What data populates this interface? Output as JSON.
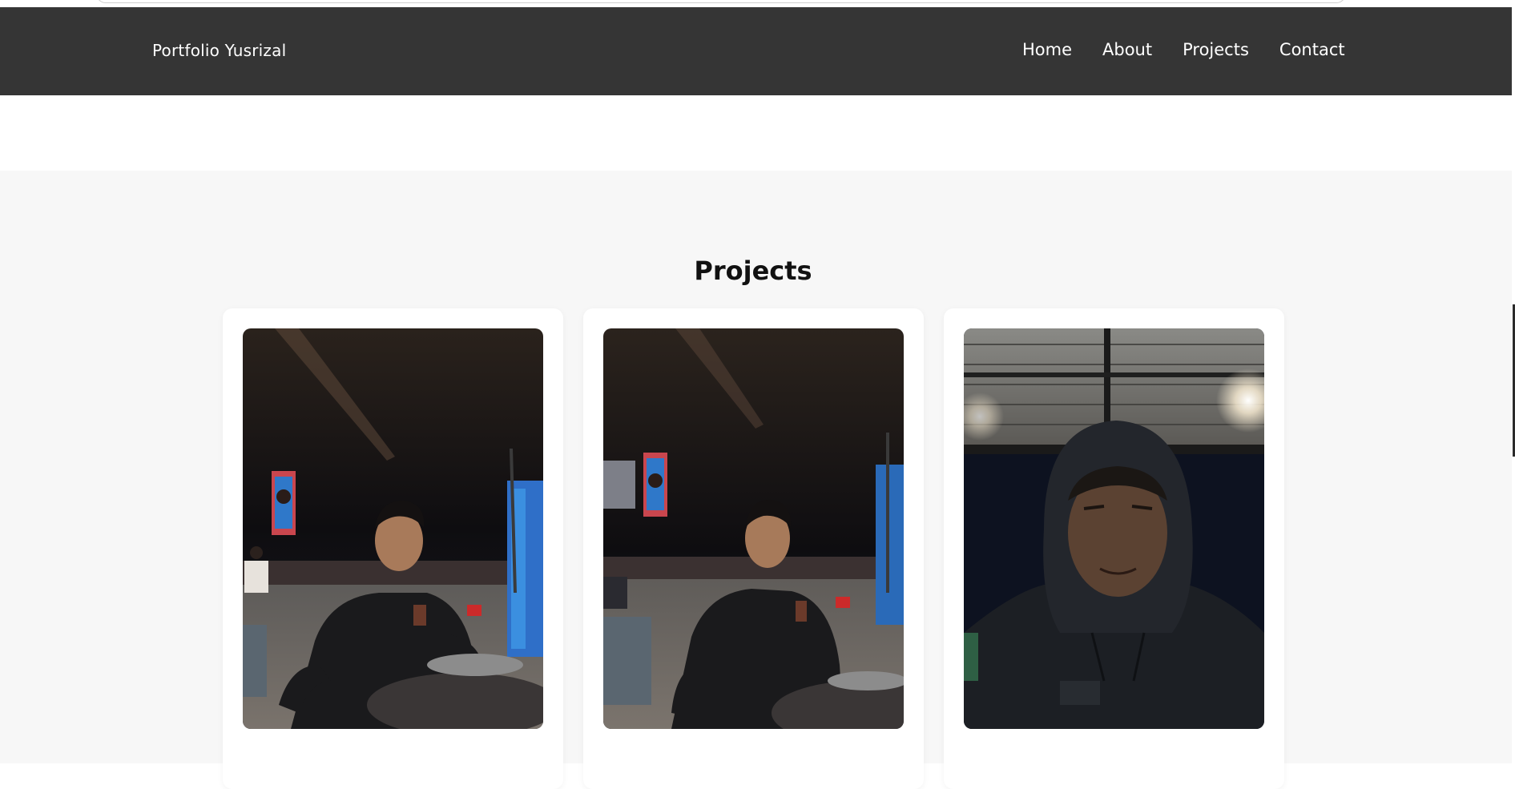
{
  "navbar": {
    "brand": "Portfolio Yusrizal",
    "links": [
      "Home",
      "About",
      "Projects",
      "Contact"
    ]
  },
  "projects": {
    "title": "Projects",
    "cards": [
      {
        "image": "night-portrait-seated-photo"
      },
      {
        "image": "night-portrait-side-photo"
      },
      {
        "image": "hooded-selfie-photo"
      }
    ]
  },
  "colors": {
    "navbar_bg": "#353535",
    "section_bg": "#f7f7f7",
    "card_bg": "#ffffff"
  }
}
